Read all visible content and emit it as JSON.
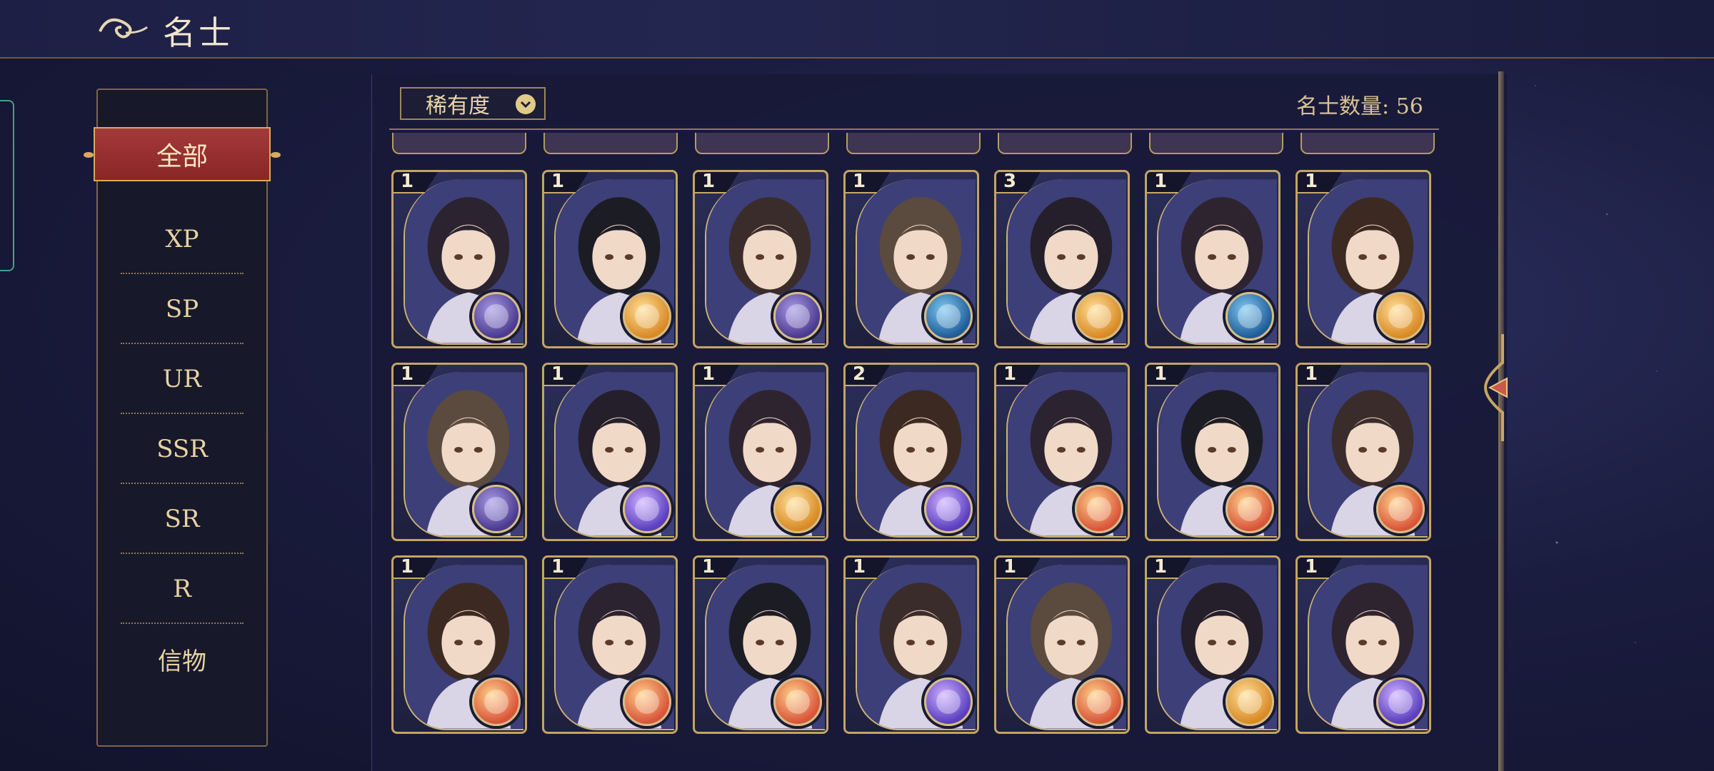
{
  "header": {
    "title": "名士"
  },
  "sidebar": {
    "active_label": "全部",
    "items": [
      {
        "label": "XP"
      },
      {
        "label": "SP"
      },
      {
        "label": "UR"
      },
      {
        "label": "SSR"
      },
      {
        "label": "SR"
      },
      {
        "label": "R"
      },
      {
        "label": "信物"
      }
    ]
  },
  "toolbar": {
    "sort_label": "稀有度",
    "count_label": "名士数量: 56"
  },
  "grid": {
    "rows": [
      [
        {
          "level": "1",
          "element": "violet"
        },
        {
          "level": "1",
          "element": "gold"
        },
        {
          "level": "1",
          "element": "violet"
        },
        {
          "level": "1",
          "element": "blue"
        },
        {
          "level": "3",
          "element": "gold"
        },
        {
          "level": "1",
          "element": "blue"
        },
        {
          "level": "1",
          "element": "gold"
        }
      ],
      [
        {
          "level": "1",
          "element": "violet"
        },
        {
          "level": "1",
          "element": "purple"
        },
        {
          "level": "1",
          "element": "gold"
        },
        {
          "level": "2",
          "element": "purple"
        },
        {
          "level": "1",
          "element": "red"
        },
        {
          "level": "1",
          "element": "red"
        },
        {
          "level": "1",
          "element": "red"
        }
      ],
      [
        {
          "level": "1",
          "element": "red"
        },
        {
          "level": "1",
          "element": "red"
        },
        {
          "level": "1",
          "element": "red"
        },
        {
          "level": "1",
          "element": "purple"
        },
        {
          "level": "1",
          "element": "red"
        },
        {
          "level": "1",
          "element": "gold"
        },
        {
          "level": "1",
          "element": "purple"
        }
      ]
    ]
  }
}
